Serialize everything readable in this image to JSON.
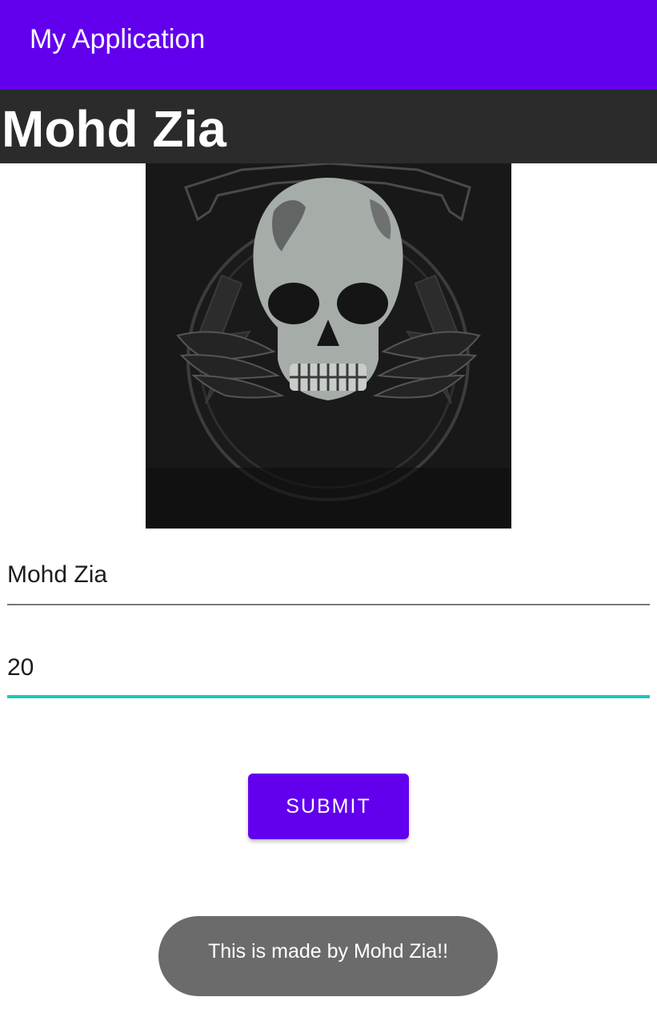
{
  "app_bar": {
    "title": "My Application",
    "color": "#6200EE"
  },
  "name_banner": {
    "text": "Mohd Zia"
  },
  "profile_image": {
    "description_icon": "skull-emblem-image"
  },
  "form": {
    "name_field": {
      "value": "Mohd Zia"
    },
    "age_field": {
      "value": "20",
      "focused": true
    },
    "focus_color": "#18C9BE"
  },
  "submit_button": {
    "label": "SUBMIT",
    "color": "#6200EE"
  },
  "toast": {
    "message": "This is made by Mohd Zia!!"
  }
}
